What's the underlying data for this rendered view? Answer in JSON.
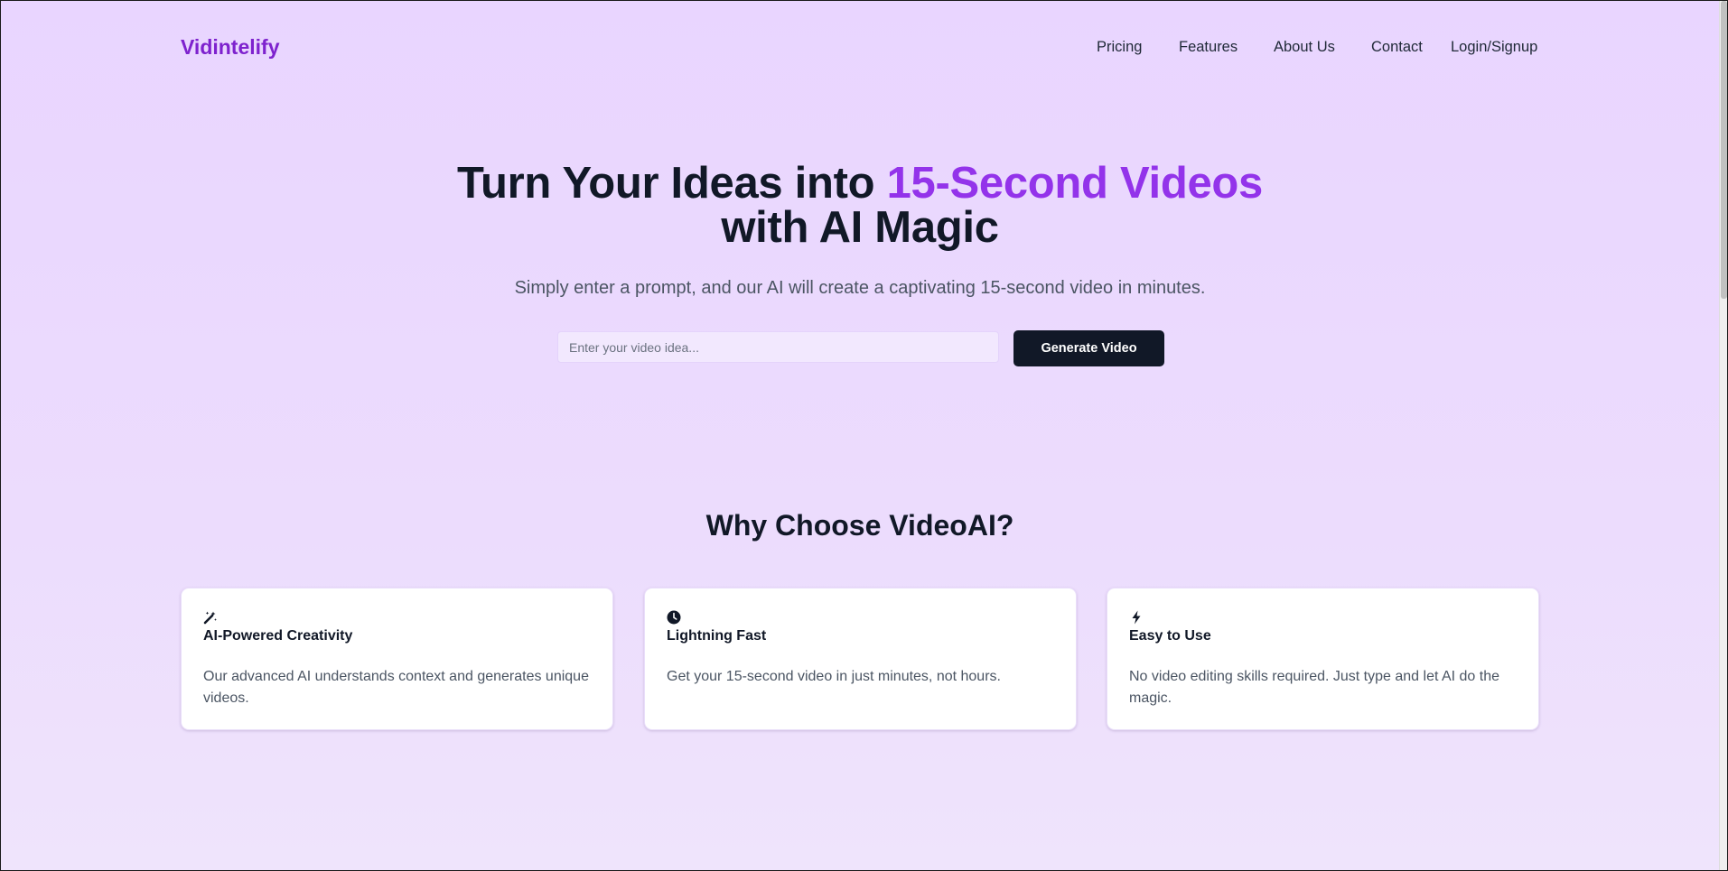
{
  "brand": {
    "name": "Vidintelify",
    "color": "#7e22ce"
  },
  "nav": {
    "links": [
      "Pricing",
      "Features",
      "About Us",
      "Contact",
      "Login/Signup"
    ]
  },
  "hero": {
    "title_part1": "Turn Your Ideas into ",
    "title_accent": "15-Second Videos",
    "title_part2": "with AI Magic",
    "subtitle": "Simply enter a prompt, and our AI will create a captivating 15-second video in minutes.",
    "input_placeholder": "Enter your video idea...",
    "input_value": "",
    "button_label": "Generate Video",
    "accent_color": "#9333ea"
  },
  "features": {
    "title": "Why Choose VideoAI?",
    "cards": [
      {
        "icon": "magic-wand-icon",
        "title": "AI-Powered Creativity",
        "description": "Our advanced AI understands context and generates unique videos."
      },
      {
        "icon": "clock-icon",
        "title": "Lightning Fast",
        "description": "Get your 15-second video in just minutes, not hours."
      },
      {
        "icon": "lightning-bolt-icon",
        "title": "Easy to Use",
        "description": "No video editing skills required. Just type and let AI do the magic."
      }
    ]
  }
}
